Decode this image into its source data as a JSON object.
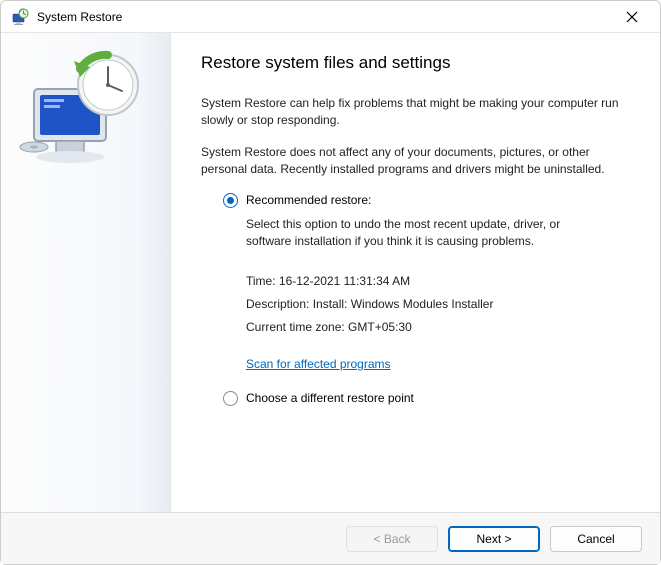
{
  "window": {
    "title": "System Restore"
  },
  "main": {
    "heading": "Restore system files and settings",
    "intro1": "System Restore can help fix problems that might be making your computer run slowly or stop responding.",
    "intro2": "System Restore does not affect any of your documents, pictures, or other personal data. Recently installed programs and drivers might be uninstalled.",
    "options": {
      "recommended": {
        "label": "Recommended restore:",
        "desc": "Select this option to undo the most recent update, driver, or software installation if you think it is causing problems.",
        "time_label": "Time: ",
        "time_value": "16-12-2021 11:31:34 AM",
        "desc_label": "Description: ",
        "desc_value": "Install: Windows Modules Installer",
        "tz_label": "Current time zone: ",
        "tz_value": "GMT+05:30",
        "scan_link": "Scan for affected programs"
      },
      "different": {
        "label": "Choose a different restore point"
      }
    }
  },
  "footer": {
    "back": "< Back",
    "next": "Next >",
    "cancel": "Cancel"
  }
}
